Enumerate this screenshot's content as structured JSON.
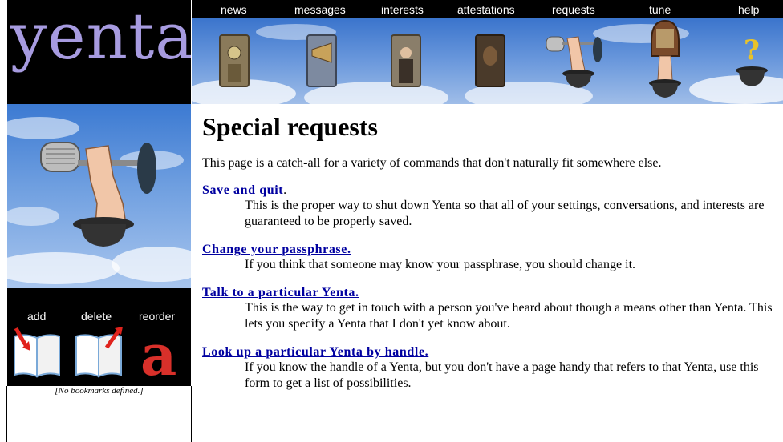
{
  "app": {
    "logo_text": "yenta"
  },
  "nav": {
    "items": [
      {
        "label": "news"
      },
      {
        "label": "messages"
      },
      {
        "label": "interests"
      },
      {
        "label": "attestations"
      },
      {
        "label": "requests"
      },
      {
        "label": "tune"
      },
      {
        "label": "help"
      }
    ]
  },
  "bookmarks": {
    "add_label": "add",
    "delete_label": "delete",
    "reorder_label": "reorder",
    "empty_text": "[No bookmarks defined.]"
  },
  "main": {
    "title": "Special requests",
    "intro": "This page is a catch-all for a variety of commands that don't naturally fit somewhere else.",
    "requests": [
      {
        "link": "Save and quit",
        "suffix": ".",
        "desc": "This is the proper way to shut down Yenta so that all of your settings, conversations, and interests are guaranteed to be properly saved."
      },
      {
        "link": "Change your passphrase.",
        "suffix": "",
        "desc": "If you think that someone may know your passphrase, you should change it."
      },
      {
        "link": "Talk to a particular Yenta.",
        "suffix": "",
        "desc": "This is the way to get in touch with a person you've heard about though a means other than Yenta. This lets you specify a Yenta that I don't yet know about."
      },
      {
        "link": "Look up a particular Yenta by handle.",
        "suffix": "",
        "desc": "If you know the handle of a Yenta, but you don't have a page handy that refers to that Yenta, use this form to get a list of possibilities."
      }
    ]
  },
  "colors": {
    "link": "#0000a0",
    "logo": "#a79be0",
    "panel_bg": "#000000",
    "sky": "#6a98dc"
  }
}
